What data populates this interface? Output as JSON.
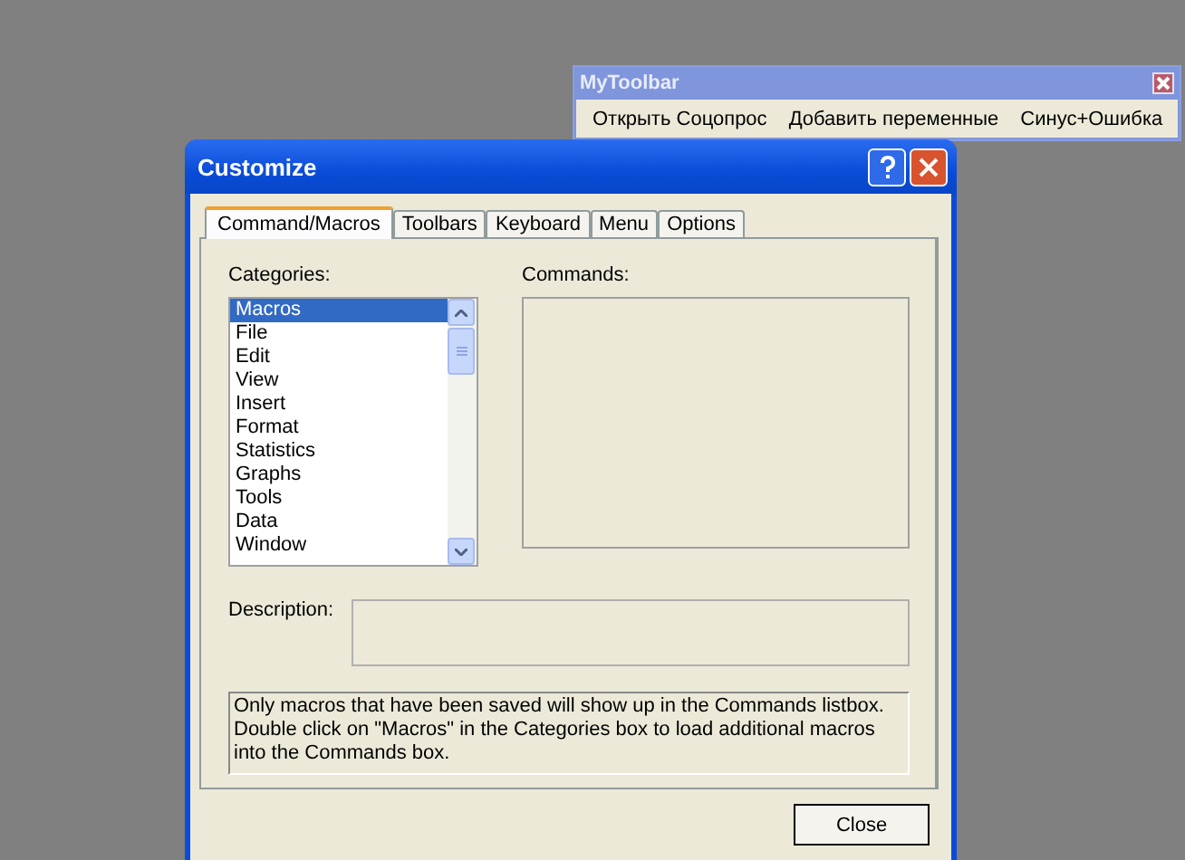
{
  "toolbar_window": {
    "title": "MyToolbar",
    "buttons": [
      "Открыть Соцопрос",
      "Добавить переменные",
      "Синус+Ошибка"
    ]
  },
  "dialog": {
    "title": "Customize",
    "tabs": [
      {
        "label": "Command/Macros",
        "selected": true
      },
      {
        "label": "Toolbars",
        "selected": false
      },
      {
        "label": "Keyboard",
        "selected": false
      },
      {
        "label": "Menu",
        "selected": false
      },
      {
        "label": "Options",
        "selected": false
      }
    ],
    "categories_label": "Categories:",
    "categories": [
      {
        "label": "Macros",
        "selected": true
      },
      {
        "label": "File",
        "selected": false
      },
      {
        "label": "Edit",
        "selected": false
      },
      {
        "label": "View",
        "selected": false
      },
      {
        "label": "Insert",
        "selected": false
      },
      {
        "label": "Format",
        "selected": false
      },
      {
        "label": "Statistics",
        "selected": false
      },
      {
        "label": "Graphs",
        "selected": false
      },
      {
        "label": "Tools",
        "selected": false
      },
      {
        "label": "Data",
        "selected": false
      },
      {
        "label": "Window",
        "selected": false
      }
    ],
    "commands_label": "Commands:",
    "description_label": "Description:",
    "info_text": "Only macros that have been saved will show up in the Commands listbox. Double click on \"Macros\" in the Categories box to load additional macros into the Commands box.",
    "close_button": "Close"
  }
}
